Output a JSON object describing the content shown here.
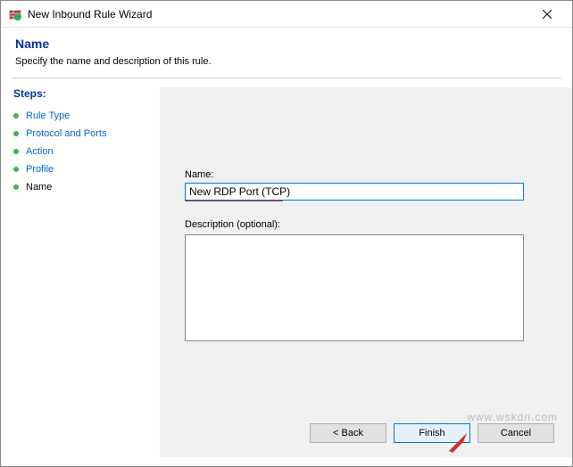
{
  "window": {
    "title": "New Inbound Rule Wizard",
    "icon_name": "firewall-icon"
  },
  "header": {
    "title": "Name",
    "description": "Specify the name and description of this rule."
  },
  "sidebar": {
    "title": "Steps:",
    "items": [
      {
        "label": "Rule Type",
        "link": true
      },
      {
        "label": "Protocol and Ports",
        "link": true
      },
      {
        "label": "Action",
        "link": true
      },
      {
        "label": "Profile",
        "link": true
      },
      {
        "label": "Name",
        "link": false
      }
    ]
  },
  "form": {
    "name_label": "Name:",
    "name_value": "New RDP Port (TCP)",
    "desc_label": "Description (optional):",
    "desc_value": ""
  },
  "buttons": {
    "back": "< Back",
    "finish": "Finish",
    "cancel": "Cancel"
  },
  "watermark": "www.wskdn.com"
}
